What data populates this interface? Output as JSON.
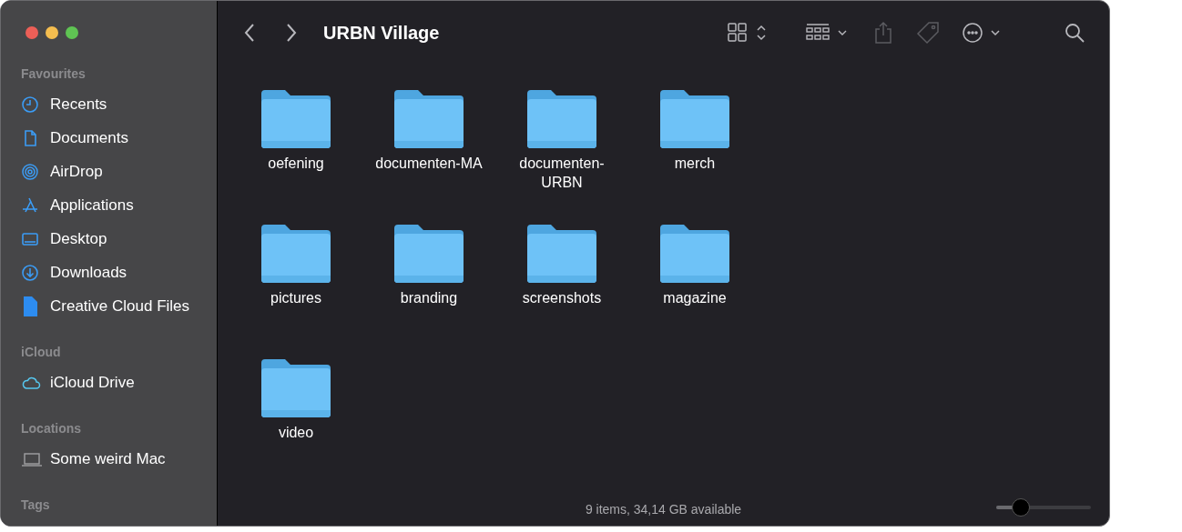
{
  "window": {
    "title": "URBN Village"
  },
  "sidebar": {
    "sections": [
      {
        "heading": "Favourites",
        "items": [
          {
            "label": "Recents"
          },
          {
            "label": "Documents"
          },
          {
            "label": "AirDrop"
          },
          {
            "label": "Applications"
          },
          {
            "label": "Desktop"
          },
          {
            "label": "Downloads"
          },
          {
            "label": "Creative Cloud Files"
          }
        ]
      },
      {
        "heading": "iCloud",
        "items": [
          {
            "label": "iCloud Drive"
          }
        ]
      },
      {
        "heading": "Locations",
        "items": [
          {
            "label": "Some weird Mac"
          }
        ]
      },
      {
        "heading": "Tags"
      }
    ]
  },
  "toolbar": [
    {
      "kind": "view",
      "disabled": false
    },
    {
      "kind": "group",
      "disabled": false
    },
    {
      "kind": "share",
      "disabled": true
    },
    {
      "kind": "tag",
      "disabled": true
    },
    {
      "kind": "more",
      "disabled": false
    },
    {
      "kind": "search",
      "disabled": false
    }
  ],
  "folders": [
    {
      "name": "oefening"
    },
    {
      "name": "documenten-MA"
    },
    {
      "name": "documenten-URBN"
    },
    {
      "name": "merch"
    },
    {
      "name": "pictures"
    },
    {
      "name": "branding"
    },
    {
      "name": "screenshots"
    },
    {
      "name": "magazine"
    },
    {
      "name": "video"
    }
  ],
  "status_bar": {
    "text": "9 items, 34,14 GB available",
    "zoom": {
      "level": 0.26
    }
  }
}
